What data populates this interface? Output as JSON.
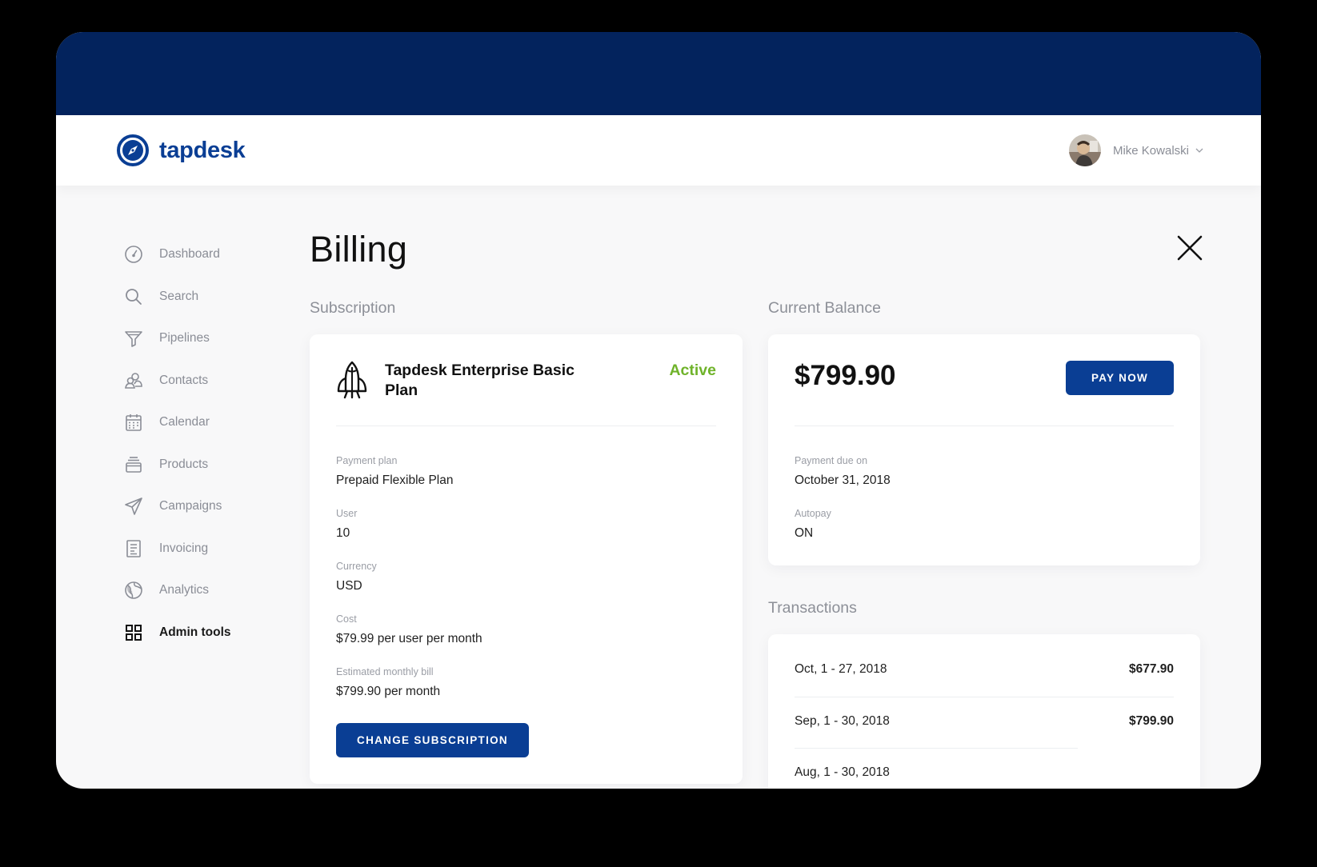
{
  "brand": {
    "name": "tapdesk",
    "color": "#0a3e94",
    "banner_color": "#03235d"
  },
  "user": {
    "name": "Mike Kowalski"
  },
  "sidebar": {
    "items": [
      {
        "label": "Dashboard",
        "icon": "dashboard-gauge-icon",
        "active": false
      },
      {
        "label": "Search",
        "icon": "search-icon",
        "active": false
      },
      {
        "label": "Pipelines",
        "icon": "funnel-icon",
        "active": false
      },
      {
        "label": "Contacts",
        "icon": "contacts-icon",
        "active": false
      },
      {
        "label": "Calendar",
        "icon": "calendar-icon",
        "active": false
      },
      {
        "label": "Products",
        "icon": "products-stack-icon",
        "active": false
      },
      {
        "label": "Campaigns",
        "icon": "paper-plane-icon",
        "active": false
      },
      {
        "label": "Invoicing",
        "icon": "invoice-icon",
        "active": false
      },
      {
        "label": "Analytics",
        "icon": "globe-icon",
        "active": false
      },
      {
        "label": "Admin tools",
        "icon": "grid-icon",
        "active": true
      }
    ]
  },
  "page": {
    "title": "Billing"
  },
  "subscription": {
    "section_label": "Subscription",
    "plan_name": "Tapdesk Enterprise Basic Plan",
    "status": "Active",
    "status_color": "#6fb32a",
    "fields": [
      {
        "label": "Payment plan",
        "value": "Prepaid Flexible Plan"
      },
      {
        "label": "User",
        "value": "10"
      },
      {
        "label": "Currency",
        "value": "USD"
      },
      {
        "label": "Cost",
        "value": "$79.99 per user per month"
      },
      {
        "label": "Estimated monthly bill",
        "value": "$799.90 per month"
      }
    ],
    "change_button": "CHANGE SUBSCRIPTION"
  },
  "balance": {
    "section_label": "Current Balance",
    "amount": "$799.90",
    "pay_button": "PAY NOW",
    "fields": [
      {
        "label": "Payment due on",
        "value": "October 31, 2018"
      },
      {
        "label": "Autopay",
        "value": "ON"
      }
    ]
  },
  "transactions": {
    "section_label": "Transactions",
    "rows": [
      {
        "range": "Oct, 1 - 27, 2018",
        "amount": "$677.90"
      },
      {
        "range": "Sep, 1 - 30, 2018",
        "amount": "$799.90"
      },
      {
        "range": "Aug, 1 - 30, 2018",
        "amount": ""
      }
    ]
  }
}
